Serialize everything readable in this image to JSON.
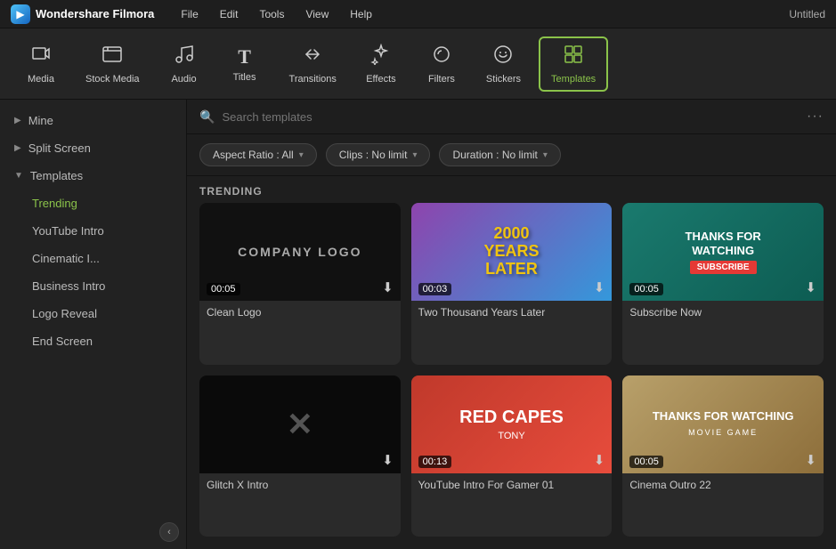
{
  "app": {
    "name": "Wondershare Filmora",
    "window_title": "Untitled"
  },
  "menu": {
    "items": [
      "File",
      "Edit",
      "Tools",
      "View",
      "Help"
    ]
  },
  "toolbar": {
    "items": [
      {
        "id": "media",
        "label": "Media",
        "icon": "📁"
      },
      {
        "id": "stock-media",
        "label": "Stock Media",
        "icon": "🎬"
      },
      {
        "id": "audio",
        "label": "Audio",
        "icon": "🎵"
      },
      {
        "id": "titles",
        "label": "Titles",
        "icon": "T"
      },
      {
        "id": "transitions",
        "label": "Transitions",
        "icon": "↔"
      },
      {
        "id": "effects",
        "label": "Effects",
        "icon": "✨"
      },
      {
        "id": "filters",
        "label": "Filters",
        "icon": "🎨"
      },
      {
        "id": "stickers",
        "label": "Stickers",
        "icon": "🌟"
      },
      {
        "id": "templates",
        "label": "Templates",
        "icon": "⊞",
        "active": true
      }
    ]
  },
  "sidebar": {
    "items": [
      {
        "id": "mine",
        "label": "Mine",
        "type": "parent",
        "expanded": false
      },
      {
        "id": "split-screen",
        "label": "Split Screen",
        "type": "parent",
        "expanded": false
      },
      {
        "id": "templates",
        "label": "Templates",
        "type": "parent",
        "expanded": true
      },
      {
        "id": "trending",
        "label": "Trending",
        "type": "child",
        "active": true
      },
      {
        "id": "youtube-intro",
        "label": "YouTube Intro",
        "type": "child"
      },
      {
        "id": "cinematic-i",
        "label": "Cinematic I...",
        "type": "child"
      },
      {
        "id": "business-intro",
        "label": "Business Intro",
        "type": "child"
      },
      {
        "id": "logo-reveal",
        "label": "Logo Reveal",
        "type": "child"
      },
      {
        "id": "end-screen",
        "label": "End Screen",
        "type": "child"
      }
    ],
    "collapse_icon": "‹"
  },
  "search": {
    "placeholder": "Search templates"
  },
  "filters": {
    "aspect_ratio": {
      "label": "Aspect Ratio : All"
    },
    "clips": {
      "label": "Clips : No limit"
    },
    "duration": {
      "label": "Duration : No limit"
    }
  },
  "trending_section": {
    "label": "TRENDING",
    "cards": [
      {
        "id": "clean-logo",
        "title": "Clean Logo",
        "duration": "00:05",
        "thumb_type": "clean-logo"
      },
      {
        "id": "two-thousand",
        "title": "Two Thousand Years Later",
        "duration": "00:03",
        "thumb_type": "two-thousand"
      },
      {
        "id": "subscribe-now",
        "title": "Subscribe Now",
        "duration": "00:05",
        "thumb_type": "subscribe"
      },
      {
        "id": "glitch-x-intro",
        "title": "Glitch X Intro",
        "duration": "",
        "thumb_type": "glitch"
      },
      {
        "id": "youtube-gamer",
        "title": "YouTube Intro For Gamer 01",
        "duration": "00:13",
        "thumb_type": "gamer"
      },
      {
        "id": "cinema-outro",
        "title": "Cinema Outro 22",
        "duration": "00:05",
        "thumb_type": "cinema"
      }
    ]
  }
}
